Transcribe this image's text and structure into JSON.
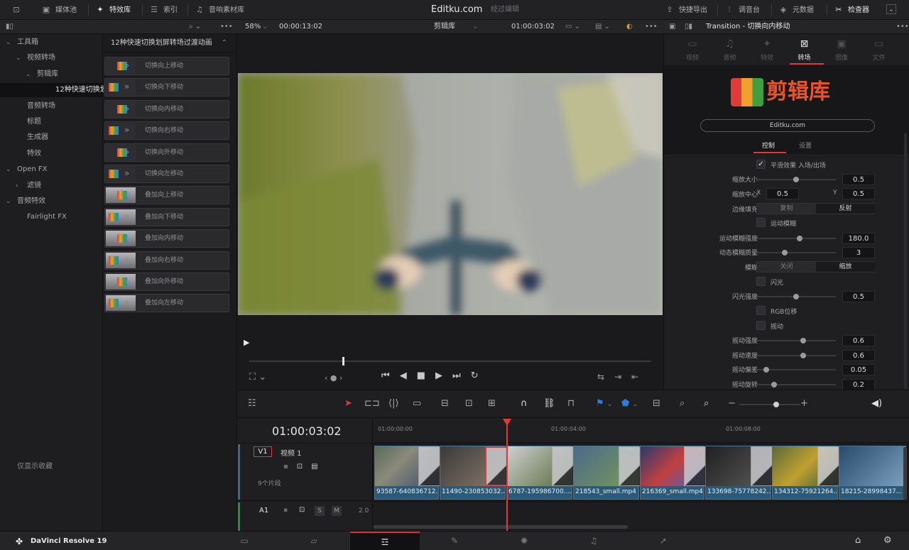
{
  "app": {
    "title": "Editku.com",
    "subtitle": "经过编辑",
    "brand": "DaVinci Resolve 19"
  },
  "topbar": {
    "left_items": [
      {
        "label": "",
        "icon": "monitor-icon"
      },
      {
        "label": "媒体池",
        "icon": "media-pool-icon"
      },
      {
        "label": "特效库",
        "icon": "magic-wand-icon"
      },
      {
        "label": "索引",
        "icon": "list-icon"
      },
      {
        "label": "音响素材库",
        "icon": "music-library-icon"
      }
    ],
    "right_items": [
      {
        "label": "快捷导出",
        "icon": "export-icon"
      },
      {
        "label": "调音台",
        "icon": "mixer-icon"
      },
      {
        "label": "元数据",
        "icon": "metadata-icon"
      },
      {
        "label": "检查器",
        "icon": "inspector-icon"
      }
    ]
  },
  "viewer_bar": {
    "zoom": "58%",
    "source_timecode": "00:00:13:02",
    "bin": "剪辑库",
    "timeline_timecode": "01:00:03:02",
    "inspector_title": "Transition - 切换向内移动"
  },
  "tree": {
    "items": [
      {
        "label": "工具箱",
        "indent": 0,
        "chevron": "v"
      },
      {
        "label": "视频转场",
        "indent": 1,
        "chevron": "v"
      },
      {
        "label": "剪辑库",
        "indent": 2,
        "chevron": "v"
      },
      {
        "label": "12种快速切换划...",
        "indent": 3,
        "chevron": ""
      },
      {
        "label": "音频转场",
        "indent": 1,
        "chevron": ""
      },
      {
        "label": "标题",
        "indent": 1,
        "chevron": ""
      },
      {
        "label": "生成器",
        "indent": 1,
        "chevron": ""
      },
      {
        "label": "特效",
        "indent": 1,
        "chevron": ""
      },
      {
        "label": "Open FX",
        "indent": 0,
        "chevron": "v"
      },
      {
        "label": "滤镜",
        "indent": 1,
        "chevron": ">"
      },
      {
        "label": "音频特效",
        "indent": 0,
        "chevron": "v"
      },
      {
        "label": "Fairlight FX",
        "indent": 1,
        "chevron": ""
      }
    ],
    "favorites_label": "仅显示收藏"
  },
  "effects": {
    "header": "12种快速切换划屏转场过渡动画",
    "items": [
      "切换向上移动",
      "切换向下移动",
      "切换向内移动",
      "切换向右移动",
      "切换向外移动",
      "切换向左移动",
      "叠加向上移动",
      "叠加向下移动",
      "叠加向内移动",
      "叠加向右移动",
      "叠加向外移动",
      "叠加向左移动"
    ]
  },
  "inspector": {
    "tabs": [
      "视频",
      "音频",
      "特效",
      "转场",
      "图像",
      "文件"
    ],
    "active_tab": "转场",
    "logo_text": "剪辑库",
    "url": "Editku.com",
    "subtabs": [
      "控制",
      "设置"
    ],
    "smooth_label": "平滑效果 入场/出场",
    "rows": [
      {
        "label": "缩放大小",
        "value": "0.5",
        "pos": 0.5
      },
      {
        "label": "运动模糊强度",
        "value": "180.0",
        "pos": 0.55
      },
      {
        "label": "动态模糊质量",
        "value": "3",
        "pos": 0.35
      },
      {
        "label": "闪光强度",
        "value": "0.5",
        "pos": 0.5
      },
      {
        "label": "摇动强度",
        "value": "0.6",
        "pos": 0.6
      },
      {
        "label": "摇动速度",
        "value": "0.6",
        "pos": 0.6
      },
      {
        "label": "摇动偏差",
        "value": "0.05",
        "pos": 0.1
      },
      {
        "label": "摇动旋转",
        "value": "0.2",
        "pos": 0.2
      }
    ],
    "center": {
      "label": "缩放中心",
      "x_label": "X",
      "x": "0.5",
      "y_label": "Y",
      "y": "0.5"
    },
    "edge": {
      "label": "边缘填充",
      "options": [
        "复制",
        "反射"
      ],
      "selected": "反射"
    },
    "blur": {
      "label": "模糊",
      "options": [
        "关闭",
        "缩放"
      ],
      "selected": "缩放"
    },
    "checks": {
      "motion_blur": "运动模糊",
      "flash": "闪光",
      "rgb": "RGB位移",
      "shake": "摇动"
    }
  },
  "timeline": {
    "timecode": "01:00:03:02",
    "ruler": [
      "01:00:00:00",
      "01:00:04:00",
      "01:00:08:00"
    ],
    "v1": {
      "id": "V1",
      "name": "视频 1",
      "clip_count": "9个片段"
    },
    "a1": {
      "id": "A1",
      "level": "2.0",
      "s": "S",
      "m": "M"
    },
    "clips": [
      "93587-640836712...",
      "11490-230853032...",
      "6787-195986700....",
      "218543_small.mp4",
      "216369_small.mp4",
      "133698-75778242...",
      "134312-75921264...",
      "18215-28998437..."
    ]
  },
  "colors": {
    "accent": "#e03a3a",
    "clip": "#2a5a7a",
    "playhead": "#e03a3a"
  },
  "pages": [
    "media-icon",
    "cut-icon",
    "edit-icon",
    "fusion-icon",
    "color-icon",
    "fairlight-icon",
    "deliver-icon"
  ]
}
